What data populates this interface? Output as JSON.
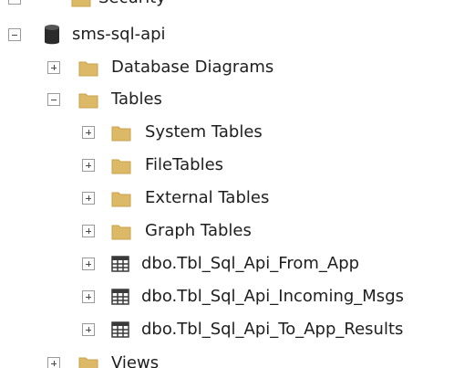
{
  "tree": {
    "top_partial_label": "Security",
    "database": {
      "label": "sms-sql-api",
      "expanded": true,
      "icon": "database-icon"
    },
    "children": [
      {
        "label": "Database Diagrams",
        "expanded": false,
        "icon": "folder-icon"
      },
      {
        "label": "Tables",
        "expanded": true,
        "icon": "folder-icon",
        "children": [
          {
            "label": "System Tables",
            "expanded": false,
            "icon": "folder-icon"
          },
          {
            "label": "FileTables",
            "expanded": false,
            "icon": "folder-icon"
          },
          {
            "label": "External Tables",
            "expanded": false,
            "icon": "folder-icon"
          },
          {
            "label": "Graph Tables",
            "expanded": false,
            "icon": "folder-icon"
          },
          {
            "label": "dbo.Tbl_Sql_Api_From_App",
            "expanded": false,
            "icon": "table-icon"
          },
          {
            "label": "dbo.Tbl_Sql_Api_Incoming_Msgs",
            "expanded": false,
            "icon": "table-icon"
          },
          {
            "label": "dbo.Tbl_Sql_Api_To_App_Results",
            "expanded": false,
            "icon": "table-icon"
          }
        ]
      },
      {
        "label": "Views",
        "expanded": false,
        "icon": "folder-icon"
      }
    ]
  },
  "colors": {
    "folder": "#dcb967",
    "folder_dark": "#c9a24a",
    "database": "#2b2b2b",
    "table_grid": "#3a3a3a",
    "expander_border": "#9a9a9a"
  }
}
